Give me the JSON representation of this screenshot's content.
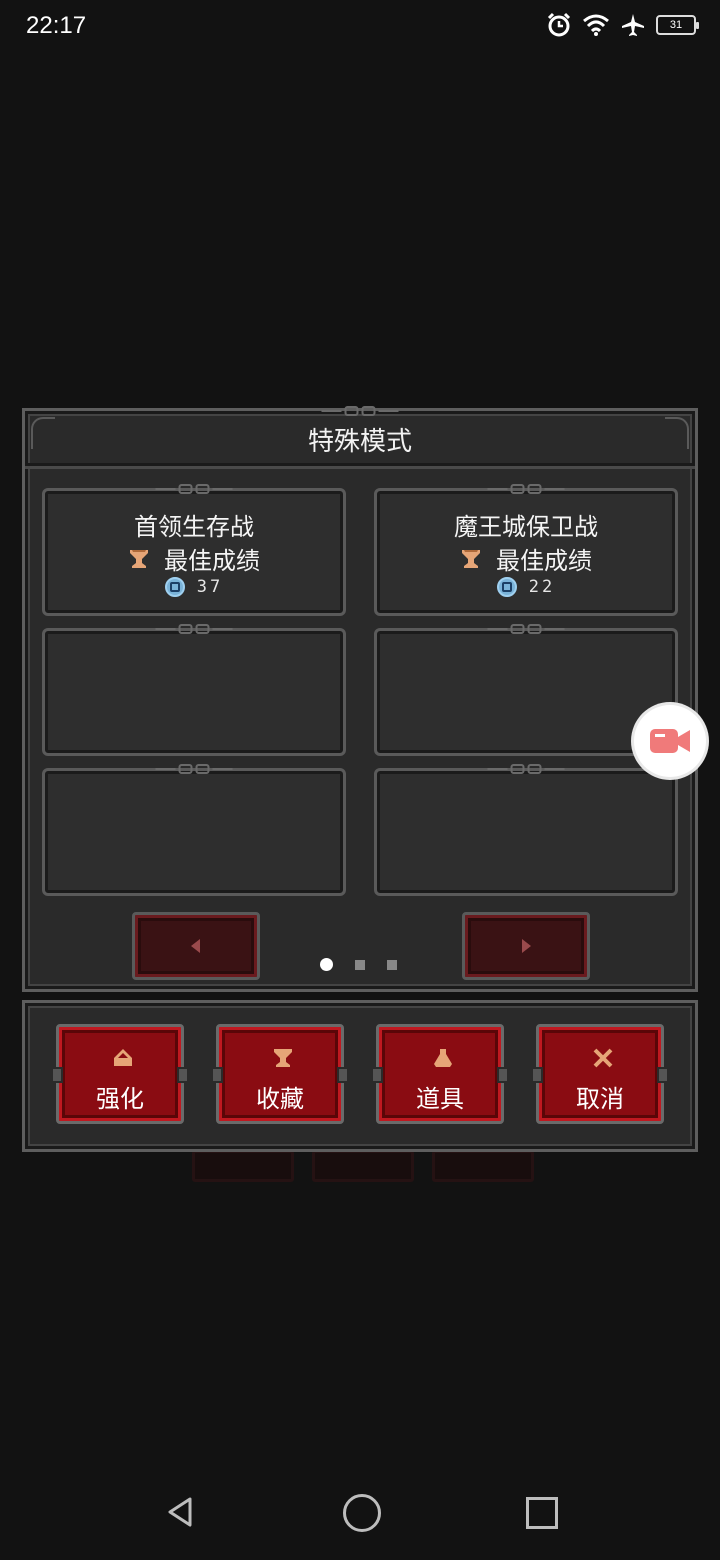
{
  "status_bar": {
    "time": "22:17",
    "battery": "31",
    "icons": [
      "alarm-icon",
      "wifi-icon",
      "airplane-mode-icon",
      "battery-icon"
    ]
  },
  "panel": {
    "title": "特殊模式"
  },
  "modes": [
    {
      "title": "首领生存战",
      "best_label": "最佳成绩",
      "score": "37"
    },
    {
      "title": "魔王城保卫战",
      "best_label": "最佳成绩",
      "score": "22"
    },
    {
      "title": "",
      "best_label": "",
      "score": ""
    },
    {
      "title": "",
      "best_label": "",
      "score": ""
    },
    {
      "title": "",
      "best_label": "",
      "score": ""
    },
    {
      "title": "",
      "best_label": "",
      "score": ""
    }
  ],
  "pagination": {
    "current": 1,
    "total": 3
  },
  "actions": [
    {
      "label": "强化",
      "icon": "upgrade-icon"
    },
    {
      "label": "收藏",
      "icon": "goblet-icon"
    },
    {
      "label": "道具",
      "icon": "potion-icon"
    },
    {
      "label": "取消",
      "icon": "crossed-swords-icon"
    }
  ],
  "colors": {
    "accent_red": "#8a0c12",
    "trophy": "#e6a577",
    "clock": "#7ab3d9",
    "record": "#f07a7a"
  }
}
